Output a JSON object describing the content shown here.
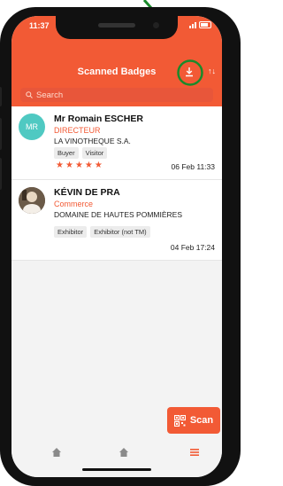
{
  "status_bar": {
    "time": "11:37"
  },
  "header": {
    "title": "Scanned Badges",
    "download_icon": "download-icon",
    "sort_label": "↑↓"
  },
  "search": {
    "placeholder": "Search"
  },
  "badges": [
    {
      "initials": "MR",
      "name": "Mr Romain ESCHER",
      "role": "DIRECTEUR",
      "company": "LA VINOTHEQUE S.A.",
      "tags": [
        "Buyer",
        "Visitor"
      ],
      "rating": 5,
      "date": "06 Feb 11:33"
    },
    {
      "initials": "",
      "name": "KÉVIN DE PRA",
      "role": "Commerce",
      "company": "DOMAINE DE HAUTES POMMIÈRES",
      "tags": [
        "Exhibitor",
        "Exhibitor (not TM)"
      ],
      "date": "04 Feb 17:24"
    }
  ],
  "scan_button": {
    "label": "Scan"
  },
  "colors": {
    "accent": "#f25a35",
    "avatar": "#4fc9c2",
    "annotation": "#1a8a2a"
  }
}
